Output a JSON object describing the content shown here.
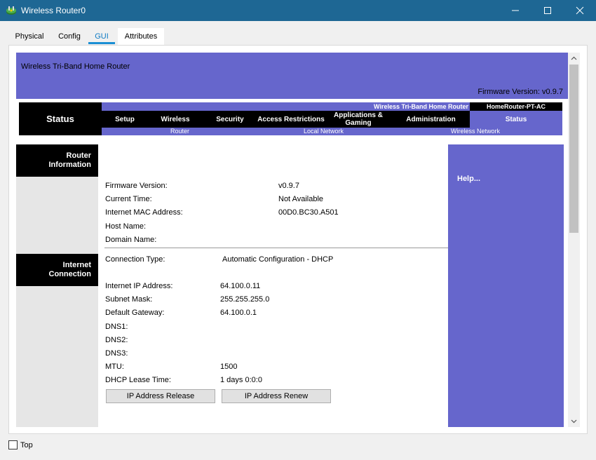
{
  "window": {
    "title": "Wireless Router0",
    "icon": "router-icon"
  },
  "tabs": [
    {
      "label": "Physical",
      "active": false
    },
    {
      "label": "Config",
      "active": false
    },
    {
      "label": "GUI",
      "active": true
    },
    {
      "label": "Attributes",
      "active": false
    }
  ],
  "router_page": {
    "header": {
      "model_text": "Wireless Tri-Band Home Router",
      "firmware_text": "Firmware Version: v0.9.7"
    },
    "nav": {
      "section": "Status",
      "product_name": "Wireless Tri-Band Home Router",
      "model_tag": "HomeRouter-PT-AC",
      "items": [
        {
          "label": "Setup"
        },
        {
          "label": "Wireless"
        },
        {
          "label": "Security"
        },
        {
          "label": "Access Restrictions"
        },
        {
          "label": "Applications & Gaming"
        },
        {
          "label": "Administration"
        },
        {
          "label": "Status"
        }
      ],
      "sub_items": [
        "Router",
        "Local Network",
        "Wireless Network"
      ],
      "selected": "Status"
    },
    "sections": {
      "router_info": {
        "title_line1": "Router",
        "title_line2": "Information",
        "fields": [
          {
            "label": "Firmware Version:",
            "value": "v0.9.7"
          },
          {
            "label": "Current Time:",
            "value": "Not Available"
          },
          {
            "label": "Internet MAC Address:",
            "value": "00D0.BC30.A501"
          },
          {
            "label": "Host Name:",
            "value": ""
          },
          {
            "label": "Domain Name:",
            "value": ""
          }
        ]
      },
      "internet": {
        "title_line1": "Internet",
        "title_line2": "Connection",
        "connection_type": {
          "label": "Connection Type:",
          "value": "Automatic Configuration - DHCP"
        },
        "fields": [
          {
            "label": "Internet IP Address:",
            "value": "64.100.0.11"
          },
          {
            "label": "Subnet Mask:",
            "value": "255.255.255.0"
          },
          {
            "label": "Default Gateway:",
            "value": "64.100.0.1"
          },
          {
            "label": "DNS1:",
            "value": ""
          },
          {
            "label": "DNS2:",
            "value": ""
          },
          {
            "label": "DNS3:",
            "value": ""
          },
          {
            "label": "MTU:",
            "value": "1500"
          },
          {
            "label": "DHCP Lease Time:",
            "value": "1 days 0:0:0"
          }
        ],
        "buttons": {
          "release": "IP Address Release",
          "renew": "IP Address Renew"
        }
      }
    },
    "help": "Help..."
  },
  "footer": {
    "top_checkbox_label": "Top",
    "top_checked": false
  },
  "colors": {
    "title_bar": "#1e6794",
    "router_purple": "#6666cc",
    "nav_black": "#000000",
    "tab_active": "#0f7bc4"
  }
}
